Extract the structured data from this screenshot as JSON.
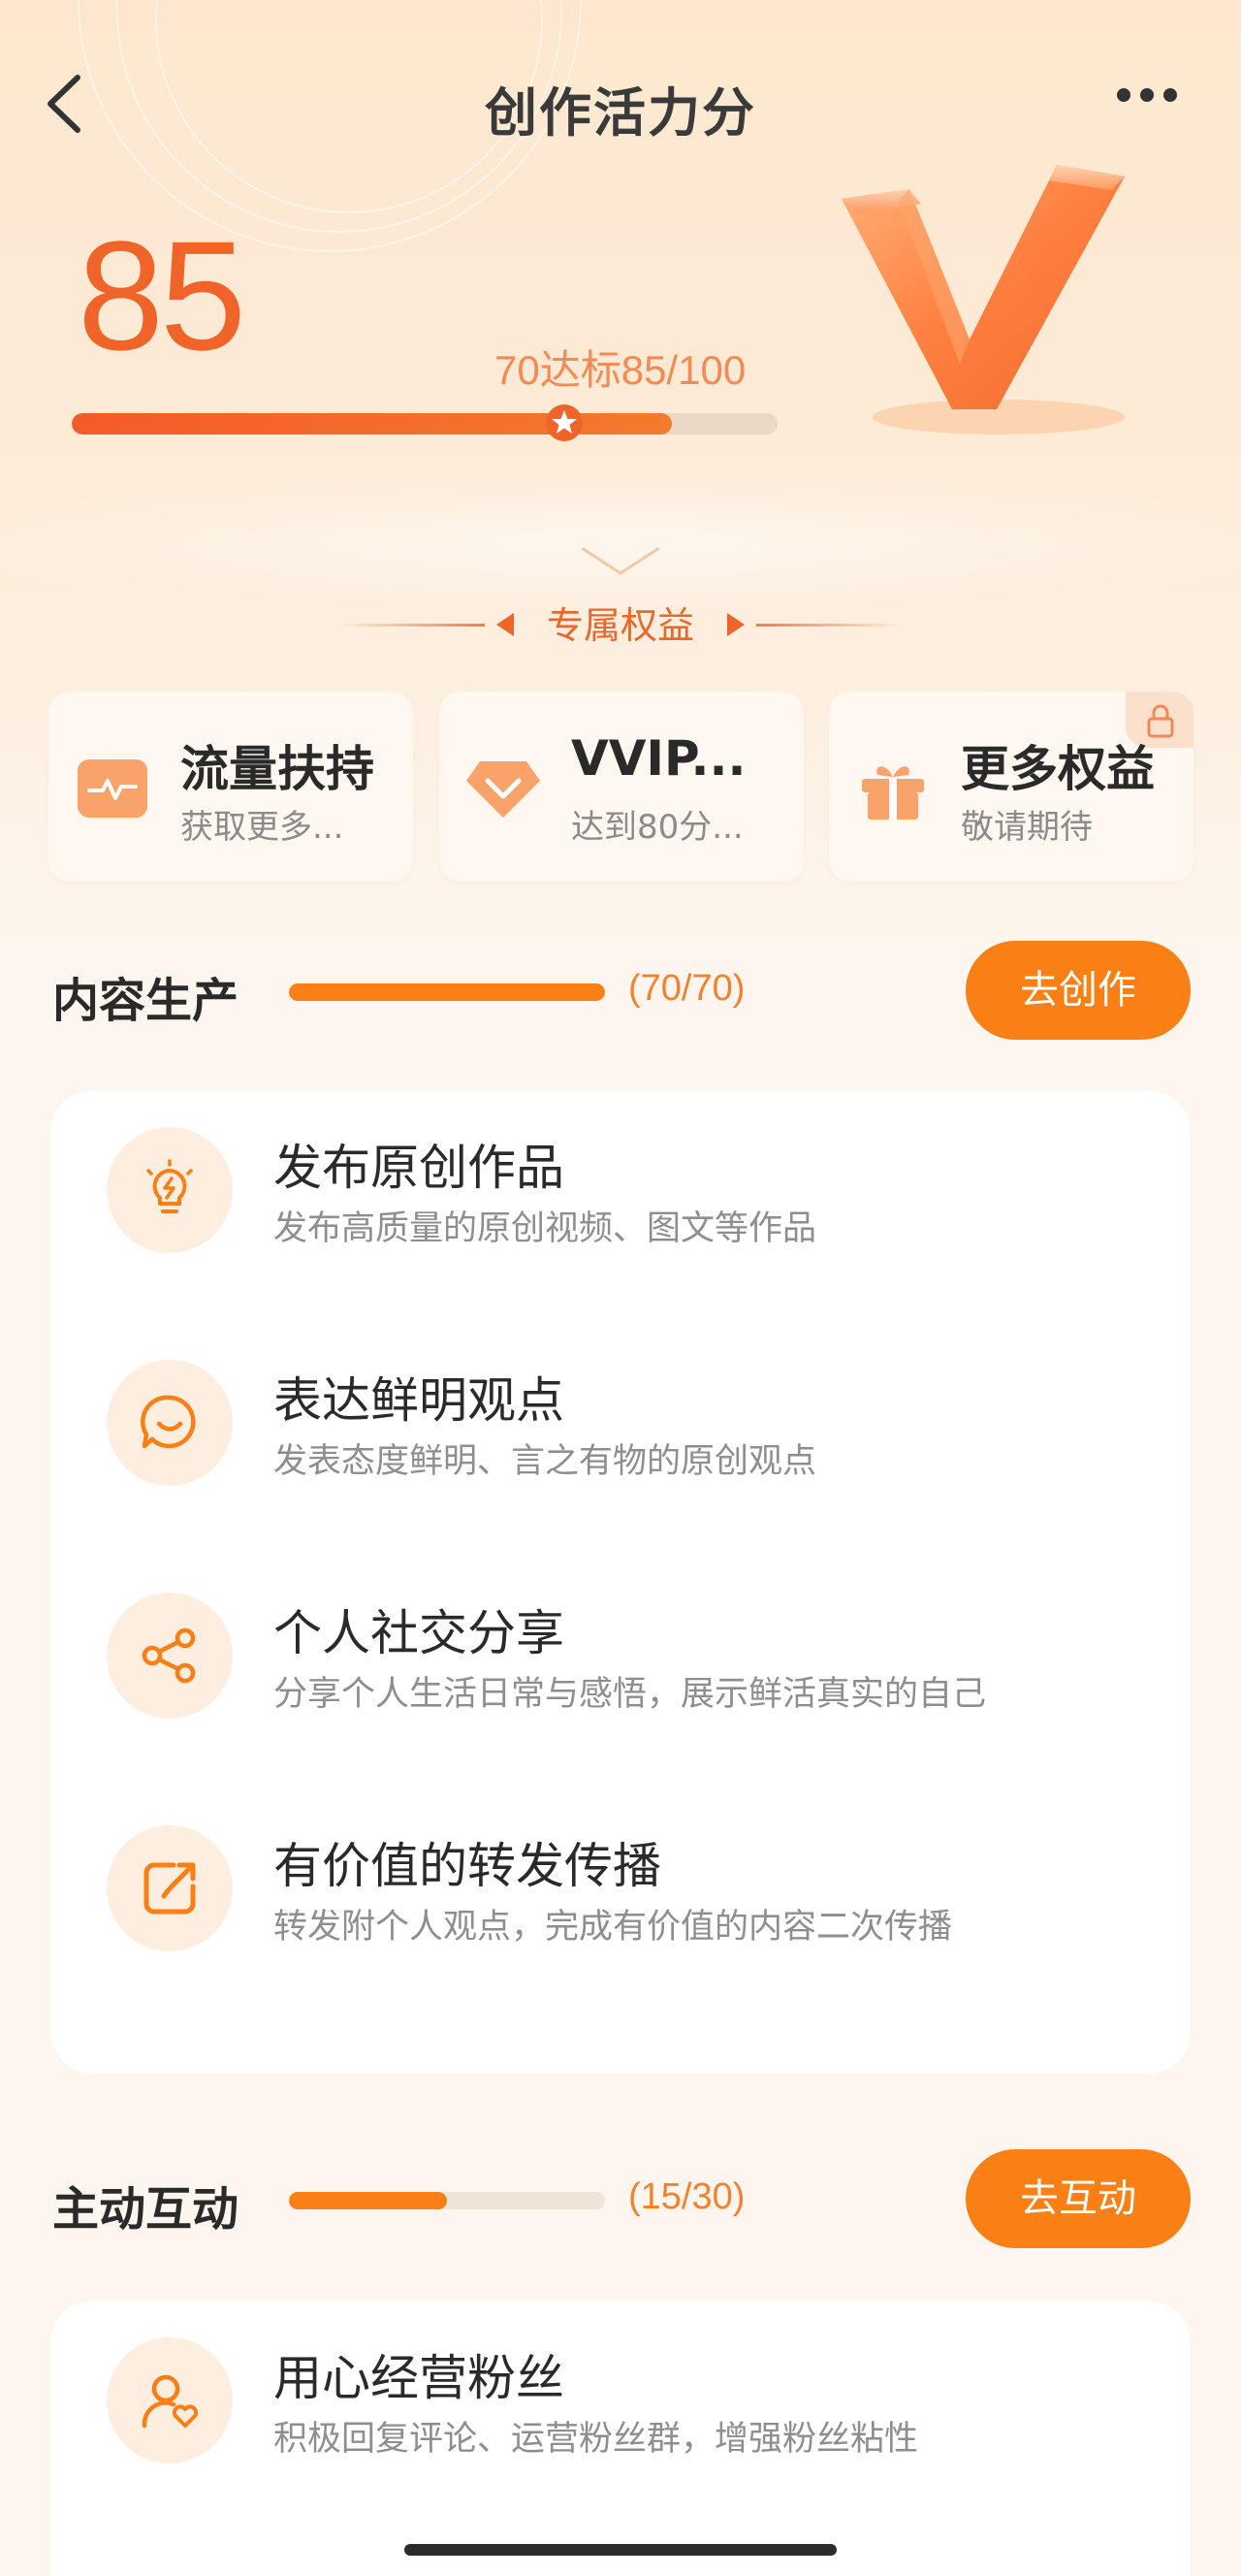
{
  "nav": {
    "title": "创作活力分"
  },
  "score": {
    "value": "85",
    "target_text": "70达标85/100",
    "progress_fraction": 0.85,
    "threshold_fraction": 0.7
  },
  "benefits": {
    "heading": "专属权益",
    "cards": [
      {
        "title": "流量扶持",
        "subtitle": "获取更多...",
        "icon": "traffic-pulse-icon"
      },
      {
        "title": "VVIP...",
        "subtitle": "达到80分...",
        "icon": "diamond-icon"
      },
      {
        "title": "更多权益",
        "subtitle": "敬请期待",
        "icon": "gift-icon",
        "locked": true
      }
    ]
  },
  "sections": [
    {
      "title": "内容生产",
      "count": "(70/70)",
      "progress_fraction": 1.0,
      "button": "去创作",
      "items": [
        {
          "title": "发布原创作品",
          "desc": "发布高质量的原创视频、图文等作品",
          "icon": "lightbulb-icon"
        },
        {
          "title": "表达鲜明观点",
          "desc": "发表态度鲜明、言之有物的原创观点",
          "icon": "smile-bubble-icon"
        },
        {
          "title": "个人社交分享",
          "desc": "分享个人生活日常与感悟，展示鲜活真实的自己",
          "icon": "share-icon"
        },
        {
          "title": "有价值的转发传播",
          "desc": "转发附个人观点，完成有价值的内容二次传播",
          "icon": "forward-icon"
        }
      ]
    },
    {
      "title": "主动互动",
      "count": "(15/30)",
      "progress_fraction": 0.5,
      "button": "去互动",
      "items": [
        {
          "title": "用心经营粉丝",
          "desc": "积极回复评论、运营粉丝群，增强粉丝粘性",
          "icon": "fan-heart-icon"
        }
      ]
    }
  ],
  "colors": {
    "accent": "#fa7f14",
    "score": "#f0642a",
    "hero_bg": "#fde7cf",
    "page_bg": "#fdf6ee"
  }
}
